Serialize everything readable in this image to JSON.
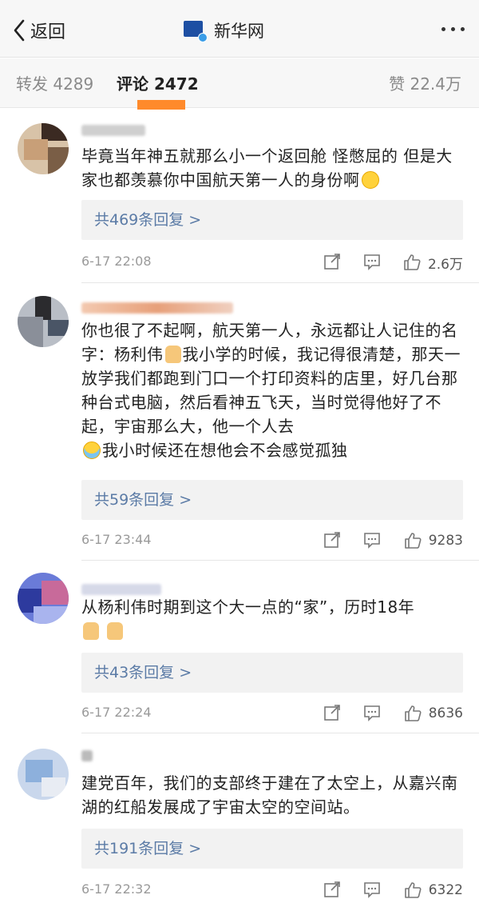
{
  "nav": {
    "back_label": "返回",
    "title": "新华网",
    "logo_text": "新华网 NEWS"
  },
  "tabs": {
    "repost": "转发 4289",
    "comments": "评论 2472",
    "likes": "赞 22.4万"
  },
  "comments": [
    {
      "text_parts": [
        "毕竟当年神五就那么小一个返回舱 怪憋屈的 但是大家也都羡慕你中国航天第一人的身份啊"
      ],
      "emojis": [
        "laugh"
      ],
      "replies": "共469条回复 >",
      "time": "6-17 22:08",
      "likes": "2.6万"
    },
    {
      "text_parts": [
        "你也很了不起啊，航天第一人，永远都让人记住的名字：杨利伟",
        "我小学的时候，我记得很清楚，那天一放学我们都跑到门口一个打印资料的店里，好几台那种台式电脑，然后看神五飞天，当时觉得他好了不起，宇宙那么大，他一个人去",
        "我小时候还在想他会不会感觉孤独"
      ],
      "emojis": [
        "thumb",
        "cry"
      ],
      "replies": "共59条回复 >",
      "time": "6-17 23:44",
      "likes": "9283"
    },
    {
      "text_parts": [
        "从杨利伟时期到这个大一点的“家”，历时18年"
      ],
      "emojis": [
        "thumb",
        "thumb"
      ],
      "replies": "共43条回复 >",
      "time": "6-17 22:24",
      "likes": "8636"
    },
    {
      "text_parts": [
        "建党百年，我们的支部终于建在了太空上，从嘉兴南湖的红船发展成了宇宙太空的空间站。"
      ],
      "emojis": [],
      "replies": "共191条回复 >",
      "time": "6-17 22:32",
      "likes": "6322"
    }
  ],
  "colors": {
    "accent_orange": "#ff8a2b",
    "reply_link": "#5b7ba6",
    "meta_gray": "#9a9a9a"
  },
  "icons": {
    "back": "chevron-left-icon",
    "more": "more-dots-icon",
    "repost": "share-out-icon",
    "comment": "comment-bubble-icon",
    "like": "thumbs-up-icon"
  }
}
